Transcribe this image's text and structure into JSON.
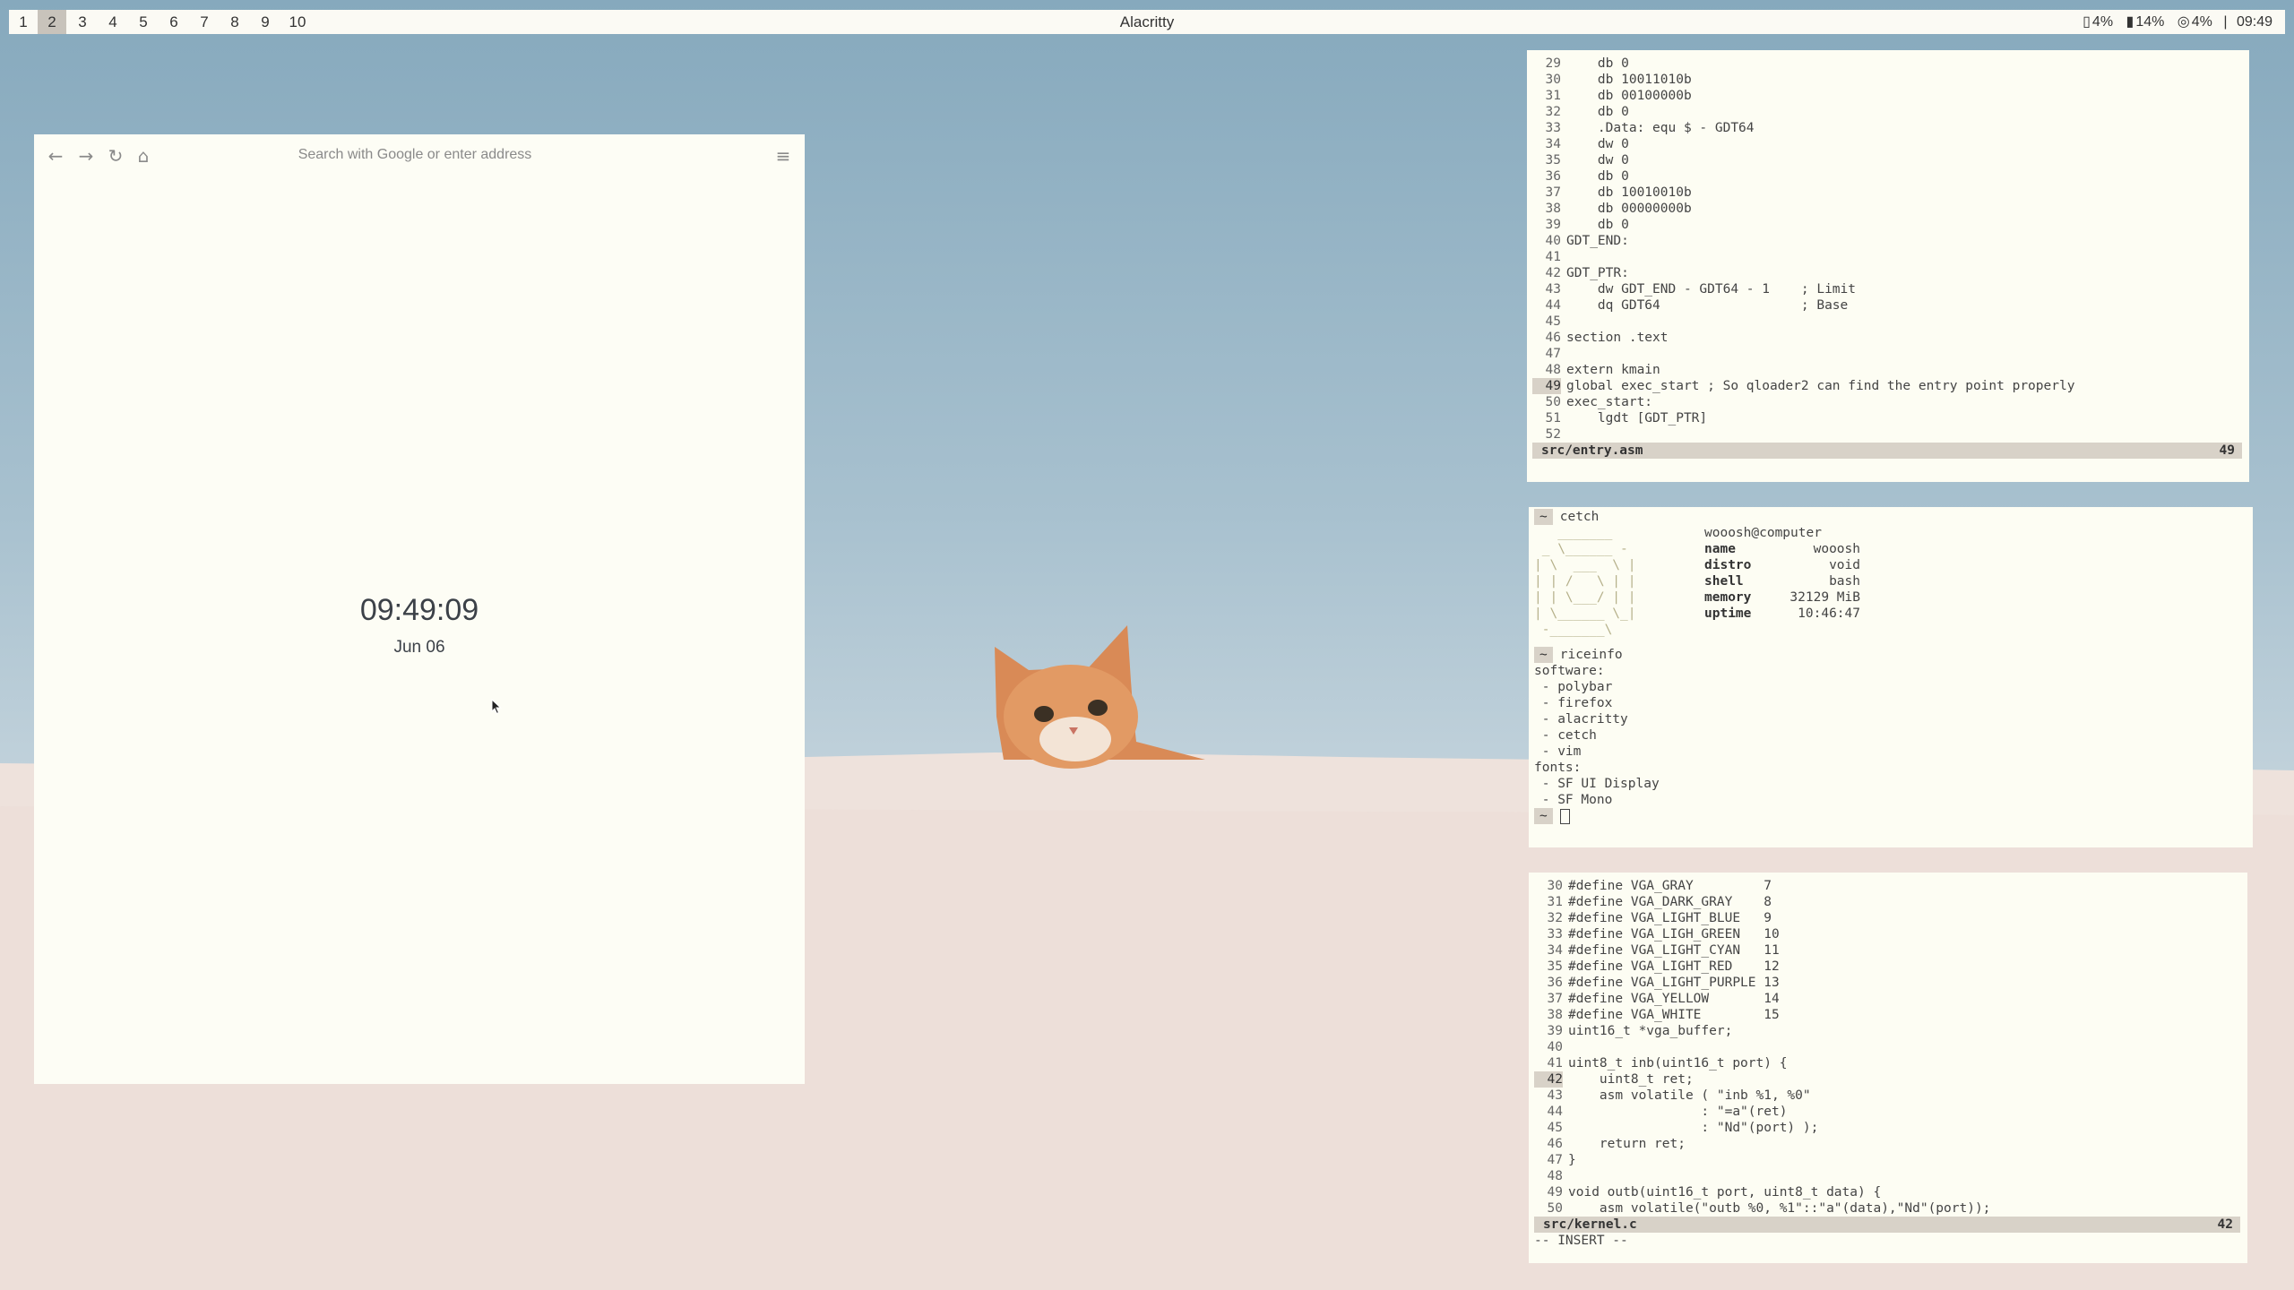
{
  "polybar": {
    "workspaces": [
      "1",
      "2",
      "3",
      "4",
      "5",
      "6",
      "7",
      "8",
      "9",
      "10"
    ],
    "active_workspace": "2",
    "window_title": "Alacritty",
    "status": {
      "disk": "4%",
      "battery": "14%",
      "cpu": "4%",
      "time": "09:49"
    }
  },
  "browser": {
    "url_placeholder": "Search with Google or enter address",
    "clock": "09:49:09",
    "date": "Jun 06"
  },
  "editor_top": {
    "lines": [
      {
        "n": "29",
        "t": "    db 0"
      },
      {
        "n": "30",
        "t": "    db 10011010b"
      },
      {
        "n": "31",
        "t": "    db 00100000b"
      },
      {
        "n": "32",
        "t": "    db 0"
      },
      {
        "n": "33",
        "t": "    .Data: equ $ - GDT64"
      },
      {
        "n": "34",
        "t": "    dw 0"
      },
      {
        "n": "35",
        "t": "    dw 0"
      },
      {
        "n": "36",
        "t": "    db 0"
      },
      {
        "n": "37",
        "t": "    db 10010010b"
      },
      {
        "n": "38",
        "t": "    db 00000000b"
      },
      {
        "n": "39",
        "t": "    db 0"
      },
      {
        "n": "40",
        "t": "GDT_END:"
      },
      {
        "n": "41",
        "t": ""
      },
      {
        "n": "42",
        "t": "GDT_PTR:"
      },
      {
        "n": "43",
        "t": "    dw GDT_END - GDT64 - 1    ; Limit"
      },
      {
        "n": "44",
        "t": "    dq GDT64                  ; Base"
      },
      {
        "n": "45",
        "t": ""
      },
      {
        "n": "46",
        "t": "section .text"
      },
      {
        "n": "47",
        "t": ""
      },
      {
        "n": "48",
        "t": "extern kmain"
      },
      {
        "n": "49",
        "t": "global exec_start ; So qloader2 can find the entry point properly"
      },
      {
        "n": "50",
        "t": "exec_start:"
      },
      {
        "n": "51",
        "t": "    lgdt [GDT_PTR]"
      },
      {
        "n": "52",
        "t": ""
      }
    ],
    "current_line": "49",
    "filename": "src/entry.asm",
    "line_indicator": "49"
  },
  "terminal": {
    "prompt": "~",
    "cmd1": "cetch",
    "ascii": [
      "   _______",
      " _ \\______ -",
      "| \\  ___  \\ |",
      "| | /   \\ | |",
      "| | \\___/ | |",
      "| \\______ \\_|",
      " -_______\\"
    ],
    "user_host": "wooosh@computer",
    "info": [
      {
        "k": "name",
        "v": "wooosh"
      },
      {
        "k": "distro",
        "v": "void"
      },
      {
        "k": "shell",
        "v": "bash"
      },
      {
        "k": "memory",
        "v": "32129 MiB"
      },
      {
        "k": "uptime",
        "v": "10:46:47"
      }
    ],
    "cmd2": "riceinfo",
    "riceinfo": [
      "software:",
      " - polybar",
      " - firefox",
      " - alacritty",
      " - cetch",
      " - vim",
      "fonts:",
      " - SF UI Display",
      " - SF Mono"
    ]
  },
  "editor_bottom": {
    "lines": [
      {
        "n": "30",
        "t": "#define VGA_GRAY         7"
      },
      {
        "n": "31",
        "t": "#define VGA_DARK_GRAY    8"
      },
      {
        "n": "32",
        "t": "#define VGA_LIGHT_BLUE   9"
      },
      {
        "n": "33",
        "t": "#define VGA_LIGH_GREEN   10"
      },
      {
        "n": "34",
        "t": "#define VGA_LIGHT_CYAN   11"
      },
      {
        "n": "35",
        "t": "#define VGA_LIGHT_RED    12"
      },
      {
        "n": "36",
        "t": "#define VGA_LIGHT_PURPLE 13"
      },
      {
        "n": "37",
        "t": "#define VGA_YELLOW       14"
      },
      {
        "n": "38",
        "t": "#define VGA_WHITE        15"
      },
      {
        "n": "39",
        "t": "uint16_t *vga_buffer;"
      },
      {
        "n": "40",
        "t": ""
      },
      {
        "n": "41",
        "t": "uint8_t inb(uint16_t port) {"
      },
      {
        "n": "42",
        "t": "    uint8_t ret;"
      },
      {
        "n": "43",
        "t": "    asm volatile ( \"inb %1, %0\""
      },
      {
        "n": "44",
        "t": "                 : \"=a\"(ret)"
      },
      {
        "n": "45",
        "t": "                 : \"Nd\"(port) );"
      },
      {
        "n": "46",
        "t": "    return ret;"
      },
      {
        "n": "47",
        "t": "}"
      },
      {
        "n": "48",
        "t": ""
      },
      {
        "n": "49",
        "t": "void outb(uint16_t port, uint8_t data) {"
      },
      {
        "n": "50",
        "t": "    asm volatile(\"outb %0, %1\"::\"a\"(data),\"Nd\"(port));"
      }
    ],
    "current_line": "42",
    "filename": "src/kernel.c",
    "line_indicator": "42",
    "mode": "-- INSERT --"
  }
}
